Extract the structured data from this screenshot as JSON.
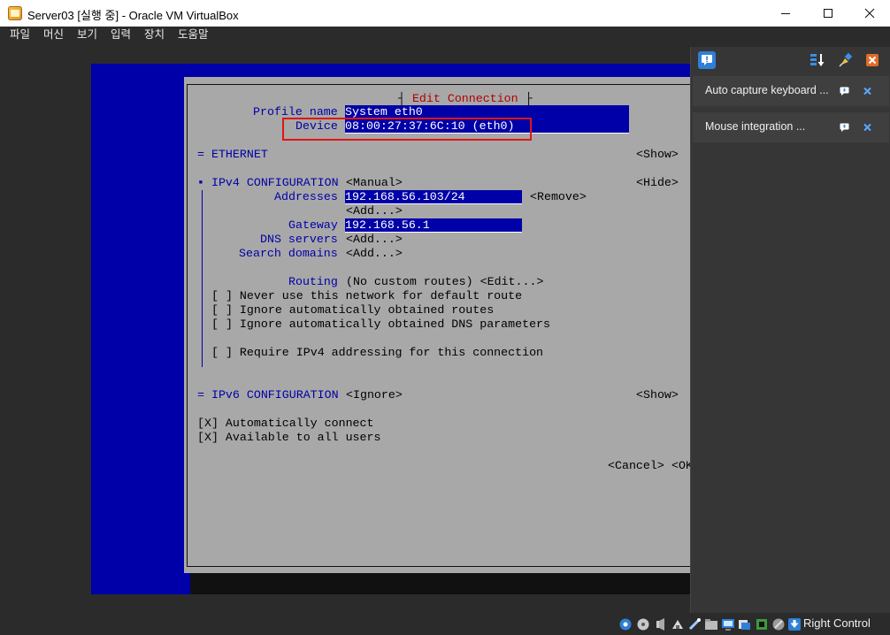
{
  "window": {
    "title": "Server03 [실행 중] - Oracle VM VirtualBox"
  },
  "menu": [
    "파일",
    "머신",
    "보기",
    "입력",
    "장치",
    "도움말"
  ],
  "dialog": {
    "title": "Edit Connection",
    "profile_name_label": "Profile name",
    "profile_name_value": "System eth0",
    "device_label": "Device",
    "device_value": "08:00:27:37:6C:10 (eth0)",
    "ethernet_label": "= ETHERNET",
    "ethernet_show": "<Show>",
    "ipv4_label": "▪ IPv4 CONFIGURATION",
    "ipv4_mode": "<Manual>",
    "ipv4_hide": "<Hide>",
    "addresses_label": "Addresses",
    "address_value": "192.168.56.103/24",
    "remove": "<Remove>",
    "add_address": "<Add...>",
    "gateway_label": "Gateway",
    "gateway_value": "192.168.56.1",
    "dns_label": "DNS servers",
    "dns_add": "<Add...>",
    "search_label": "Search domains",
    "search_add": "<Add...>",
    "routing_label": "Routing",
    "routing_value": "(No custom routes) <Edit...>",
    "never_default": "[ ] Never use this network for default route",
    "ignore_routes": "[ ] Ignore automatically obtained routes",
    "ignore_dns": "[ ] Ignore automatically obtained DNS parameters",
    "require_ipv4": "[ ] Require IPv4 addressing for this connection",
    "ipv6_label": "= IPv6 CONFIGURATION",
    "ipv6_mode": "<Ignore>",
    "ipv6_show": "<Show>",
    "auto_connect": "[X] Automatically connect",
    "all_users": "[X] Available to all users",
    "cancel": "<Cancel>",
    "ok": "<OK>"
  },
  "notifications": [
    {
      "text": "Auto capture keyboard ..."
    },
    {
      "text": "Mouse integration ..."
    }
  ],
  "statusbar": {
    "host_key": "Right Control"
  },
  "colors": {
    "tui_blue": "#0000a8",
    "tui_gray": "#a8a8a8",
    "title_red": "#b00000",
    "highlight_red": "#e01515"
  }
}
